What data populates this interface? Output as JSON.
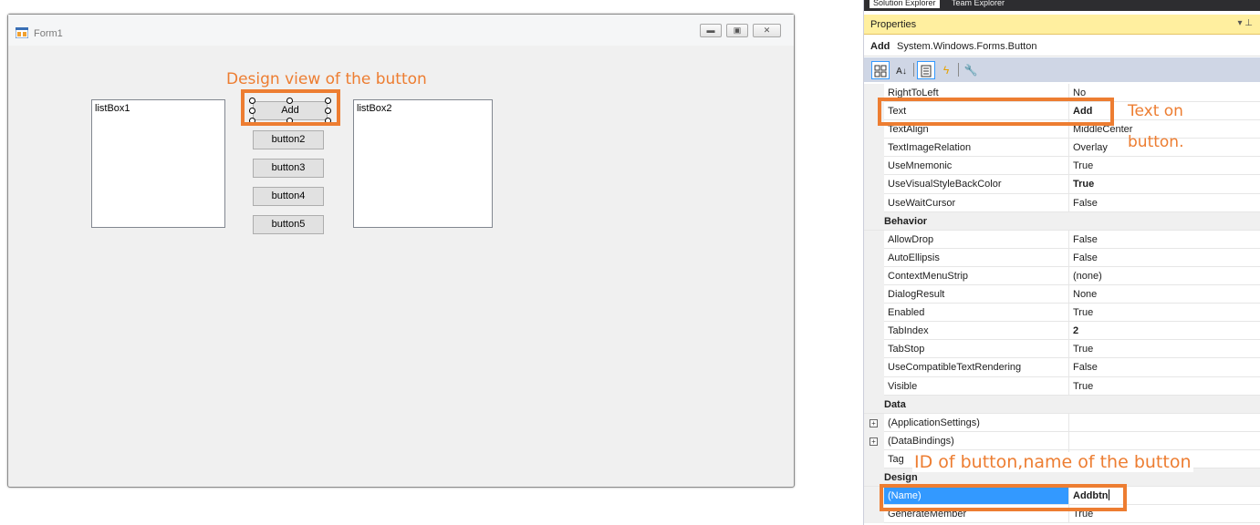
{
  "form": {
    "title": "Form1",
    "window_buttons": [
      "minimize-icon",
      "maximize-icon",
      "close-icon"
    ],
    "listbox1": "listBox1",
    "listbox2": "listBox2",
    "buttons": [
      "Add",
      "button2",
      "button3",
      "button4",
      "button5"
    ]
  },
  "annotations": {
    "design_view": "Design view of the button",
    "text_on_button_line1": "Text on",
    "text_on_button_line2": "button.",
    "id_of_button": "ID of button,name of the button"
  },
  "panel": {
    "top_tabs": [
      "Solution Explorer",
      "Team Explorer"
    ],
    "header_title": "Properties",
    "header_controls": "▾ ⊥",
    "object_name": "Add",
    "object_type": "System.Windows.Forms.Button",
    "toolbar_icons": [
      "categorized-icon",
      "alphabetical-icon",
      "properties-icon",
      "events-icon",
      "property-pages-icon"
    ],
    "rows": [
      {
        "name": "RightToLeft",
        "value": "No",
        "kind": "prop"
      },
      {
        "name": "Text",
        "value": "Add",
        "kind": "prop",
        "bold": true
      },
      {
        "name": "TextAlign",
        "value": "MiddleCenter",
        "kind": "prop"
      },
      {
        "name": "TextImageRelation",
        "value": "Overlay",
        "kind": "prop"
      },
      {
        "name": "UseMnemonic",
        "value": "True",
        "kind": "prop"
      },
      {
        "name": "UseVisualStyleBackColor",
        "value": "True",
        "kind": "prop",
        "bold": true
      },
      {
        "name": "UseWaitCursor",
        "value": "False",
        "kind": "prop"
      },
      {
        "name": "Behavior",
        "value": "",
        "kind": "category",
        "expander": "⊟"
      },
      {
        "name": "AllowDrop",
        "value": "False",
        "kind": "prop"
      },
      {
        "name": "AutoEllipsis",
        "value": "False",
        "kind": "prop"
      },
      {
        "name": "ContextMenuStrip",
        "value": "(none)",
        "kind": "prop"
      },
      {
        "name": "DialogResult",
        "value": "None",
        "kind": "prop"
      },
      {
        "name": "Enabled",
        "value": "True",
        "kind": "prop"
      },
      {
        "name": "TabIndex",
        "value": "2",
        "kind": "prop",
        "bold": true
      },
      {
        "name": "TabStop",
        "value": "True",
        "kind": "prop"
      },
      {
        "name": "UseCompatibleTextRendering",
        "value": "False",
        "kind": "prop"
      },
      {
        "name": "Visible",
        "value": "True",
        "kind": "prop"
      },
      {
        "name": "Data",
        "value": "",
        "kind": "category",
        "expander": "⊟"
      },
      {
        "name": "(ApplicationSettings)",
        "value": "",
        "kind": "prop",
        "expander": "⊞"
      },
      {
        "name": "(DataBindings)",
        "value": "",
        "kind": "prop",
        "expander": "⊞"
      },
      {
        "name": "Tag",
        "value": "",
        "kind": "prop"
      },
      {
        "name": "Design",
        "value": "",
        "kind": "category",
        "expander": "⊟"
      },
      {
        "name": "(Name)",
        "value": "Addbtn",
        "kind": "prop",
        "bold": true,
        "selected": true
      },
      {
        "name": "GenerateMember",
        "value": "True",
        "kind": "prop"
      }
    ]
  },
  "colors": {
    "annotation": "#ed7d31",
    "selection": "#3399ff",
    "panel_header": "#ffef9f",
    "toolbar": "#cfd6e5"
  }
}
